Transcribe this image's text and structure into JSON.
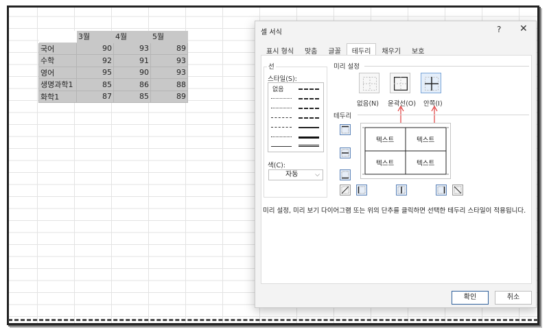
{
  "sheet": {
    "header": [
      "",
      "3월",
      "4월",
      "5월"
    ],
    "rows": [
      {
        "label": "국어",
        "values": [
          "90",
          "93",
          "89"
        ]
      },
      {
        "label": "수학",
        "values": [
          "92",
          "91",
          "93"
        ]
      },
      {
        "label": "영어",
        "values": [
          "95",
          "90",
          "93"
        ]
      },
      {
        "label": "생명과학1",
        "values": [
          "85",
          "86",
          "88"
        ]
      },
      {
        "label": "화학1",
        "values": [
          "87",
          "85",
          "89"
        ]
      }
    ]
  },
  "dialog": {
    "title": "셀 서식",
    "help_label": "?",
    "close_label": "✕",
    "tabs": [
      "표시 형식",
      "맞춤",
      "글꼴",
      "테두리",
      "채우기",
      "보호"
    ],
    "active_tab": "테두리",
    "line_group": "선",
    "style_label": "스타일(S):",
    "style_none": "없음",
    "color_label": "색(C):",
    "color_value": "자동",
    "preset_group": "미리 설정",
    "preset_none": "없음(N)",
    "preset_outline": "윤곽선(O)",
    "preset_inside": "안쪽(I)",
    "border_group": "테두리",
    "preview_cells": [
      "텍스트",
      "텍스트",
      "텍스트",
      "텍스트"
    ],
    "description": "미리 설정, 미리 보기 다이어그램 또는 위의 단추를 클릭하면 선택한 테두리 스타일이 적용됩니다.",
    "ok_label": "확인",
    "cancel_label": "취소"
  },
  "colors": {
    "table_border": "#2d6a3a",
    "selection_fill": "#c8c8c8",
    "selected_preset": "#7aa5d8",
    "annotation_arrow": "#e03a3a"
  }
}
